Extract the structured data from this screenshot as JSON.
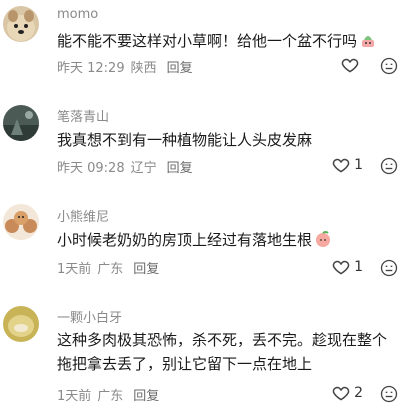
{
  "comments": [
    {
      "username": "momo",
      "text": "能不能不要这样对小草啊！给他一个盆不行吗",
      "emoji": "pot-plant-emoji",
      "time": "昨天 12:29",
      "location": "陕西",
      "reply_label": "回复",
      "likes": ""
    },
    {
      "username": "笔落青山",
      "text": "我真想不到有一种植物能让人头皮发麻",
      "emoji": "",
      "time": "昨天 09:28",
      "location": "辽宁",
      "reply_label": "回复",
      "likes": "1"
    },
    {
      "username": "小熊维尼",
      "text": "小时候老奶奶的房顶上经过有落地生根",
      "emoji": "peach-emoji",
      "time": "1天前",
      "location": "广东",
      "reply_label": "回复",
      "likes": "1"
    },
    {
      "username": "一颗小白牙",
      "text": "这种多肉极其恐怖，杀不死，丢不完。趁现在整个拖把拿去丢了，别让它留下一点在地上",
      "emoji": "",
      "time": "1天前",
      "location": "广东",
      "reply_label": "回复",
      "likes": "2"
    }
  ],
  "icons": {
    "like": "heart-outline-icon",
    "dislike": "dislike-face-icon"
  },
  "colors": {
    "text": "#1a1a1a",
    "muted": "#8a8a8a"
  }
}
